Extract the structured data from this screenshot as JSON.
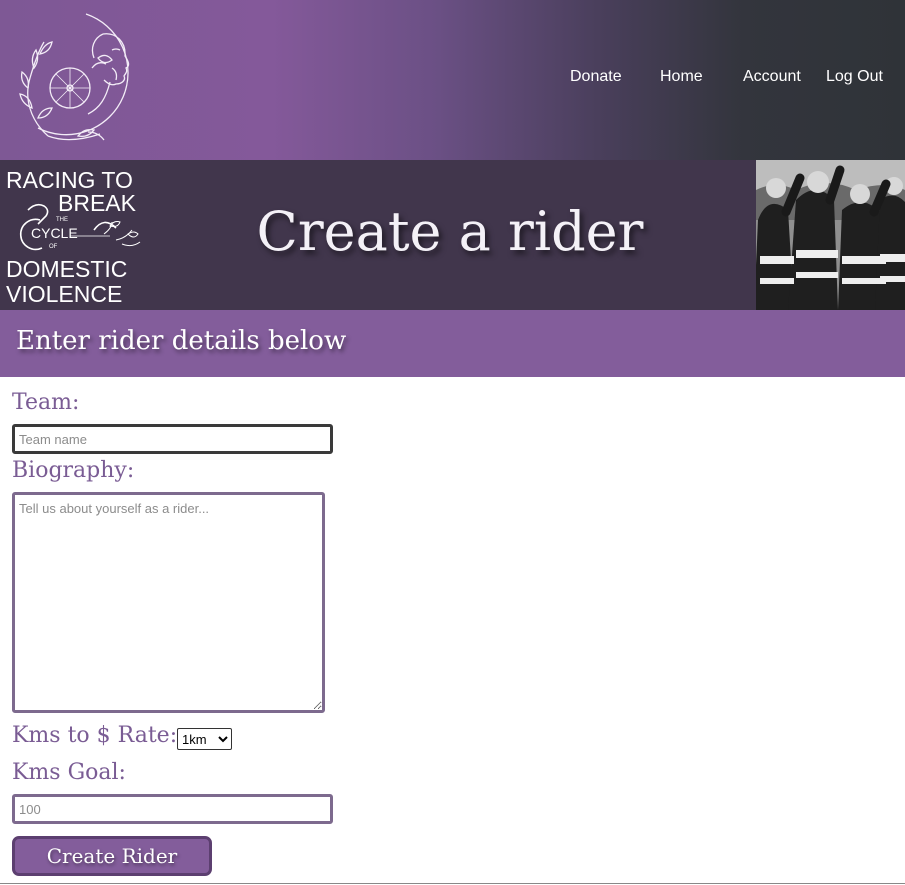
{
  "header": {
    "nav": [
      {
        "label": "Donate"
      },
      {
        "label": "Home"
      },
      {
        "label": "Account"
      },
      {
        "label": "Log Out"
      }
    ]
  },
  "hero": {
    "title": "Create a rider",
    "logo_lines": [
      "RACING TO",
      "BREAK",
      "THE",
      "CYCLE",
      "OF",
      "DOMESTIC",
      "VIOLENCE"
    ],
    "photo_caption": "Racing to break the cycle of domestic violence"
  },
  "form": {
    "subheader": "Enter rider details below",
    "team": {
      "label": "Team:",
      "placeholder": "Team name",
      "value": ""
    },
    "biography": {
      "label": "Biography:",
      "placeholder": "Tell us about yourself as a rider...",
      "value": ""
    },
    "rate": {
      "label": "Kms to $ Rate:",
      "selected": "1km",
      "options": [
        "1km"
      ]
    },
    "goal": {
      "label": "Kms Goal:",
      "placeholder": "100",
      "value": ""
    },
    "submit_label": "Create Rider"
  },
  "colors": {
    "brand_purple": "#835d9b",
    "hero_bg": "#41364c",
    "label_purple": "#7a5c94",
    "nav_text": "#ffffff"
  }
}
